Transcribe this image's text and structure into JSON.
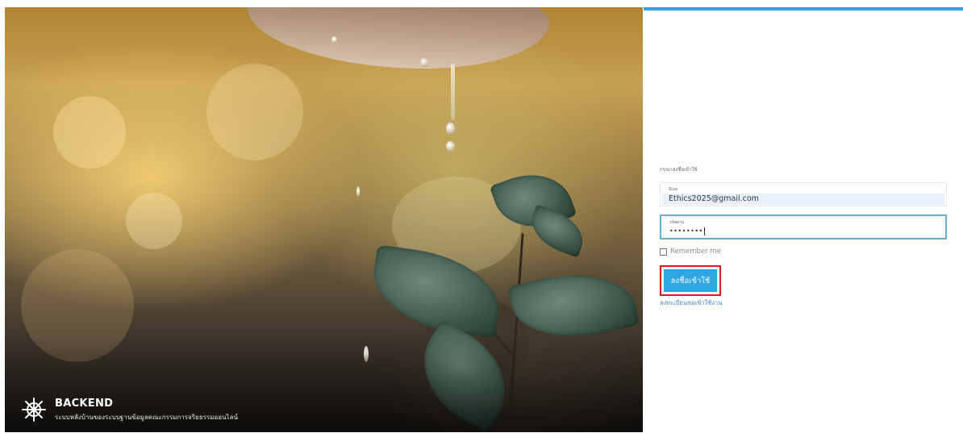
{
  "colors": {
    "accent": "#2ea6e2",
    "top_bar": "#31a2dc",
    "highlight_outline": "#e01b1b",
    "link": "#3a86c8"
  },
  "brand": {
    "icon": "ship-wheel-icon",
    "title": "BACKEND",
    "subtitle": "ระบบหลังบ้านของระบบฐานข้อมูลคณะกรรมการจริยธรรมออนไลน์"
  },
  "login": {
    "prompt": "กรุณาลงชื่อเข้าใช้",
    "email_label": "อีเมล",
    "email_value": "Ethics2025@gmail.com",
    "password_label": "รหัสผ่าน",
    "password_value": "••••••••",
    "remember_label": "Remember me",
    "submit_label": "ลงชื่อเข้าใช้",
    "register_link": "ลงทะเบียนขอเข้าใช้งาน"
  }
}
